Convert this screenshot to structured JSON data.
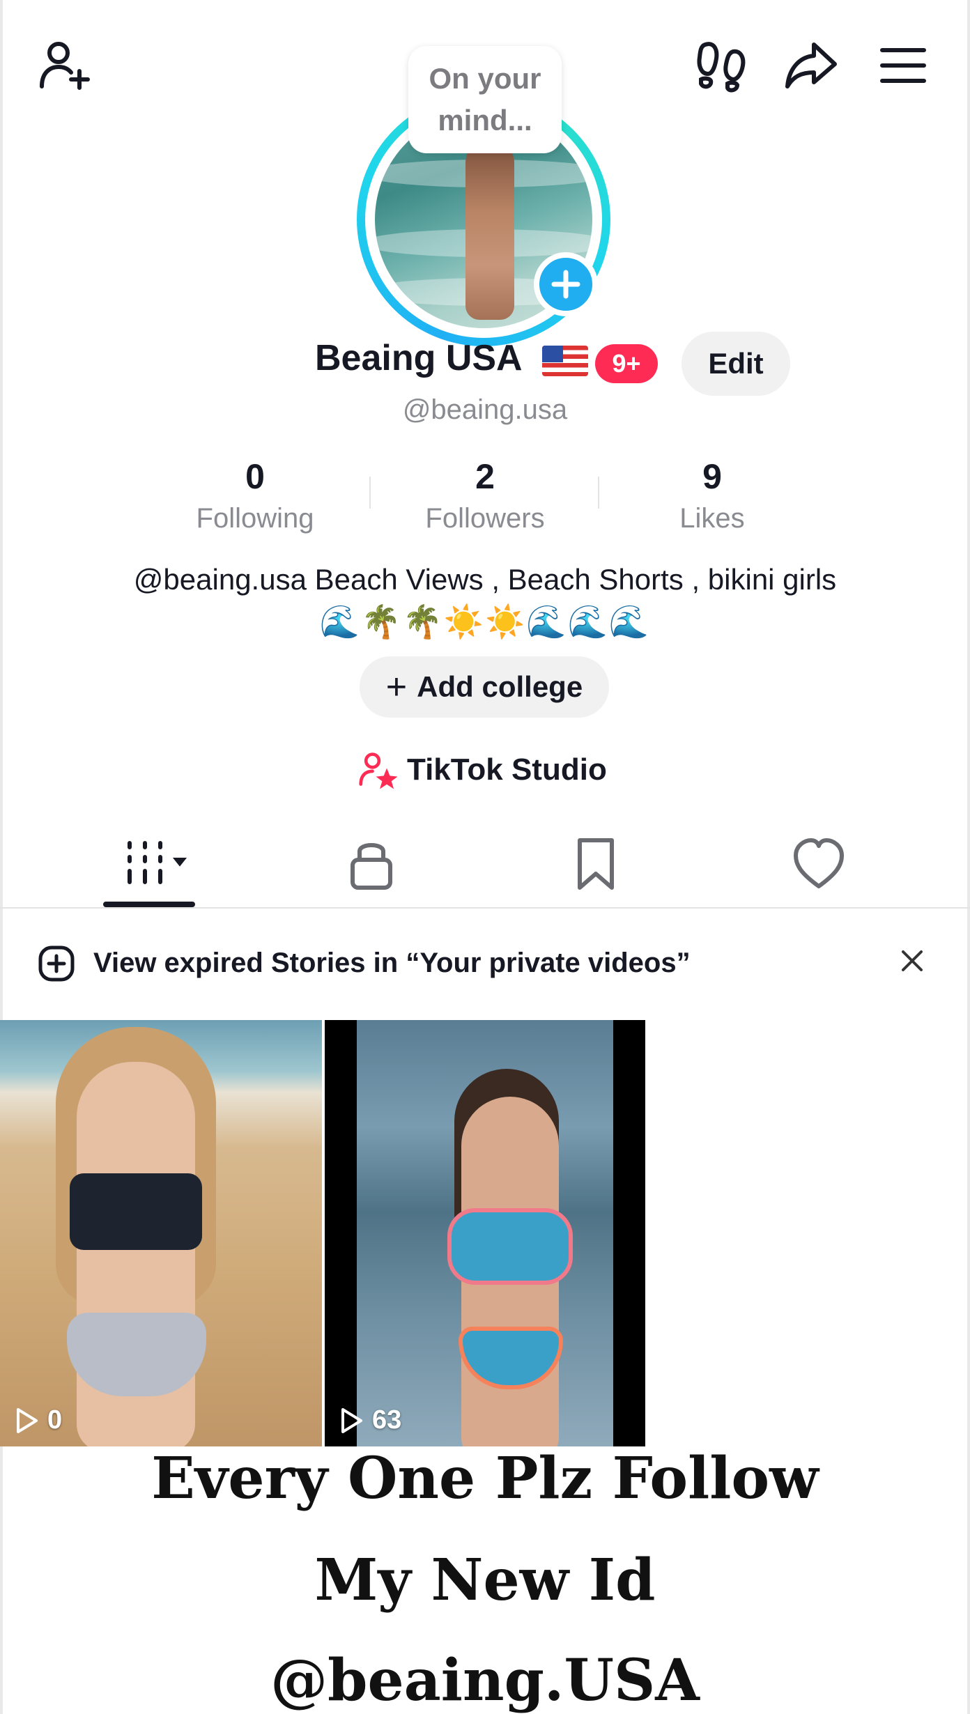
{
  "top_bar": {
    "icons": [
      "add-friend-icon",
      "footprints-icon",
      "share-icon",
      "menu-icon"
    ]
  },
  "avatar": {
    "thought_bubble": "On your mind...",
    "add_story_icon": "plus-icon",
    "ring_color": "#20d5ec"
  },
  "profile": {
    "display_name": "Beaing USA",
    "flag": "us-flag-icon",
    "notification_badge": "9+",
    "edit_label": "Edit",
    "handle": "@beaing.usa"
  },
  "stats": [
    {
      "value": "0",
      "label": "Following"
    },
    {
      "value": "2",
      "label": "Followers"
    },
    {
      "value": "9",
      "label": "Likes"
    }
  ],
  "bio": {
    "text": "@beaing.usa Beach Views , Beach Shorts , bikini girls",
    "emoji": "🌊🌴🌴☀️☀️🌊🌊🌊"
  },
  "add_college": {
    "plus": "+",
    "label": "Add college"
  },
  "studio": {
    "icon": "creator-star-icon",
    "label": "TikTok Studio"
  },
  "tabs": [
    {
      "icon": "videos-grid-icon",
      "active": true
    },
    {
      "icon": "lock-icon",
      "active": false
    },
    {
      "icon": "bookmark-icon",
      "active": false
    },
    {
      "icon": "heart-icon",
      "active": false
    }
  ],
  "banner": {
    "icon": "story-add-icon",
    "text": "View expired Stories in “Your private videos”",
    "close_icon": "close-icon"
  },
  "videos": [
    {
      "views": "0"
    },
    {
      "views": "63"
    }
  ],
  "caption": {
    "line1": "Every One Plz Follow",
    "line2": "My New Id",
    "line3": "@beaing.USA"
  },
  "colors": {
    "accent_red": "#fe2c55",
    "ring_cyan": "#20d5ec",
    "plus_blue": "#20aef0",
    "text_primary": "#161823",
    "text_secondary": "#8a8b91",
    "button_bg": "#f1f1f2"
  }
}
